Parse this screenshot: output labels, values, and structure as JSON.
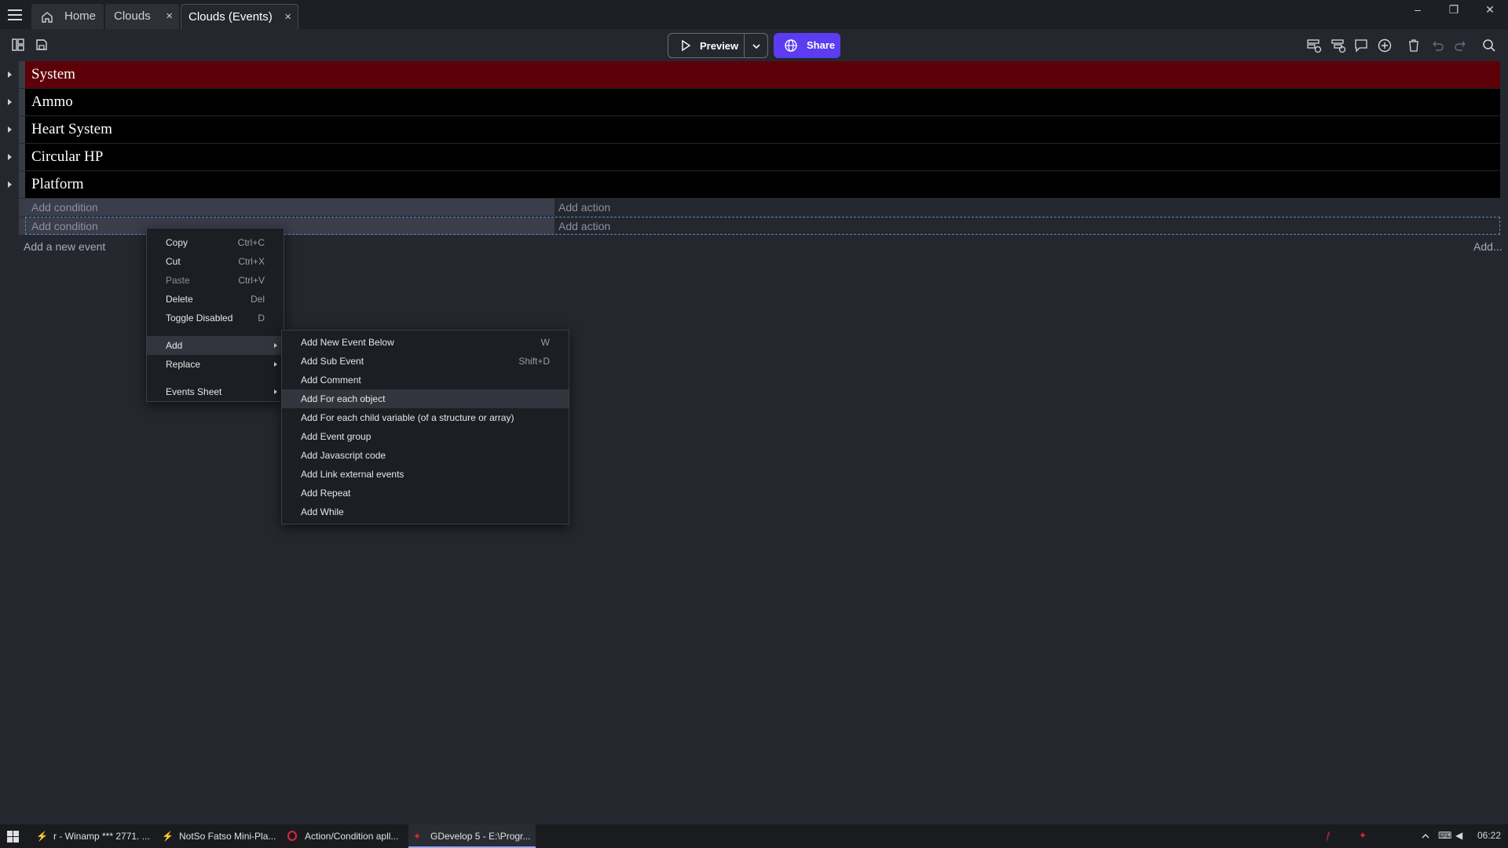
{
  "tabs": [
    {
      "label": "Home",
      "icon": "home-icon"
    },
    {
      "label": "Clouds",
      "close": "×"
    },
    {
      "label": "Clouds (Events)",
      "close": "×",
      "active": true
    }
  ],
  "window_controls": {
    "minimize": "–",
    "restore": "❐",
    "close": "✕"
  },
  "toolbar": {
    "preview_label": "Preview",
    "share_label": "Share",
    "accent_color": "#5b3cf0"
  },
  "events": [
    {
      "name": "System",
      "color": "#5e0008"
    },
    {
      "name": "Ammo",
      "color": "#000000"
    },
    {
      "name": "Heart System",
      "color": "#000000"
    },
    {
      "name": "Circular HP",
      "color": "#000000"
    },
    {
      "name": "Platform",
      "color": "#000000"
    }
  ],
  "standard_events": [
    {
      "condition": "Add condition",
      "action": "Add action"
    },
    {
      "condition": "Add condition",
      "action": "Add action"
    }
  ],
  "footer": {
    "add_event": "Add a new event",
    "add_more": "Add..."
  },
  "context_menu": {
    "items": [
      {
        "label": "Copy",
        "shortcut": "Ctrl+C"
      },
      {
        "label": "Cut",
        "shortcut": "Ctrl+X"
      },
      {
        "label": "Paste",
        "shortcut": "Ctrl+V",
        "disabled": true
      },
      {
        "label": "Delete",
        "shortcut": "Del"
      },
      {
        "label": "Toggle Disabled",
        "shortcut": "D"
      },
      {
        "label": "Add",
        "submenu": true
      },
      {
        "label": "Replace",
        "submenu": true
      },
      {
        "label": "Events Sheet",
        "submenu": true
      }
    ]
  },
  "add_submenu": {
    "items": [
      {
        "label": "Add New Event Below",
        "shortcut": "W"
      },
      {
        "label": "Add Sub Event",
        "shortcut": "Shift+D"
      },
      {
        "label": "Add Comment"
      },
      {
        "label": "Add For each object",
        "highlighted": true
      },
      {
        "label": "Add For each child variable (of a structure or array)"
      },
      {
        "label": "Add Event group"
      },
      {
        "label": "Add Javascript code"
      },
      {
        "label": "Add Link external events"
      },
      {
        "label": "Add Repeat"
      },
      {
        "label": "Add While"
      }
    ]
  },
  "taskbar": {
    "items": [
      {
        "label": "r - Winamp *** 2771. ...",
        "icon": "winamp-icon"
      },
      {
        "label": "NotSo Fatso Mini-Pla...",
        "icon": "winamp-icon"
      },
      {
        "label": "Action/Condition apll...",
        "icon": "opera-icon"
      },
      {
        "label": "GDevelop 5 - E:\\Progr...",
        "icon": "gdevelop-icon"
      }
    ],
    "clock": "06:22"
  }
}
